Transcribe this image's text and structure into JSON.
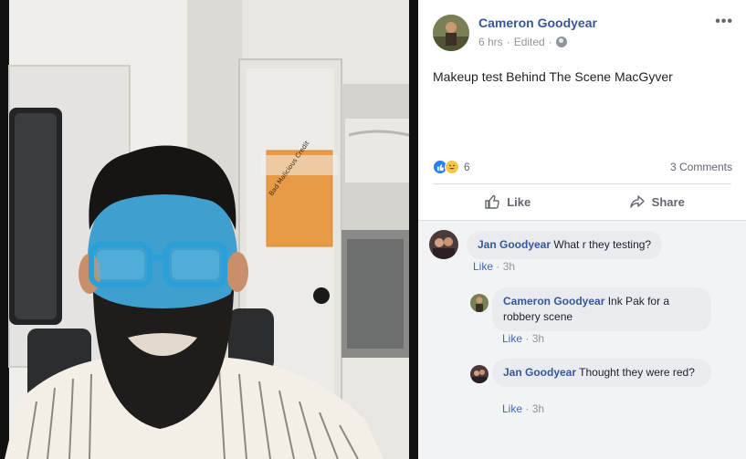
{
  "post": {
    "author": "Cameron Goodyear",
    "time": "6 hrs",
    "edited": "Edited",
    "separator": "·",
    "more": "•••",
    "text": "Makeup test Behind The Scene MacGyver"
  },
  "photo": {
    "envelope_text": "Bad Malicious Credit"
  },
  "reactions": {
    "count": "6",
    "comments": "3 Comments",
    "types": [
      "like-icon",
      "haha-icon"
    ]
  },
  "actions": {
    "like": "Like",
    "share": "Share"
  },
  "comments": [
    {
      "name": "Jan Goodyear",
      "text": "What r they testing?",
      "like": "Like",
      "sep": "·",
      "time": "3h"
    },
    {
      "name": "Cameron Goodyear",
      "text": "Ink Pak for a robbery scene",
      "like": "Like",
      "sep": "·",
      "time": "3h"
    },
    {
      "name": "Jan Goodyear",
      "text": "Thought they were red?",
      "like": "Like",
      "sep": "·",
      "time": "3h"
    }
  ],
  "colors": {
    "link": "#365899",
    "meta": "#90949c",
    "comment_bg": "#f2f3f5",
    "bubble": "#e9ebee",
    "like_blue": "#2a7ff5",
    "face_paint": "#3fa0cf"
  }
}
